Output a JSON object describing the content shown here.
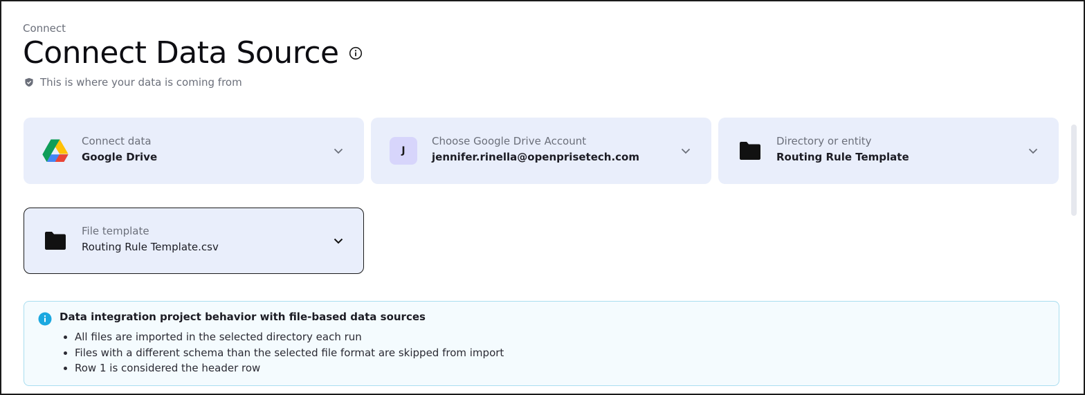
{
  "breadcrumb": "Connect",
  "page": {
    "title": "Connect Data Source",
    "subtitle": "This is where your data is coming from"
  },
  "cards": {
    "connect_data": {
      "label": "Connect data",
      "value": "Google Drive",
      "icon": "google-drive-icon"
    },
    "account": {
      "label": "Choose Google Drive Account",
      "value": "jennifer.rinella@openprisetech.com",
      "avatar_initial": "J"
    },
    "directory": {
      "label": "Directory or entity",
      "value": "Routing Rule Template",
      "icon": "folder-icon"
    },
    "file_template": {
      "label": "File template",
      "value": "Routing Rule Template.csv",
      "icon": "folder-icon"
    }
  },
  "notice": {
    "title": "Data integration project behavior with file-based data sources",
    "items": [
      "All files are imported in the selected directory each run",
      "Files with a different schema than the selected file format are skipped from import",
      "Row 1 is considered the header row"
    ]
  },
  "colors": {
    "card_bg": "#e9eefb",
    "notice_bg": "#f4fbfe",
    "notice_border": "#a9def0",
    "info_accent": "#1ba8e0",
    "avatar_bg": "#d7d5fb"
  }
}
